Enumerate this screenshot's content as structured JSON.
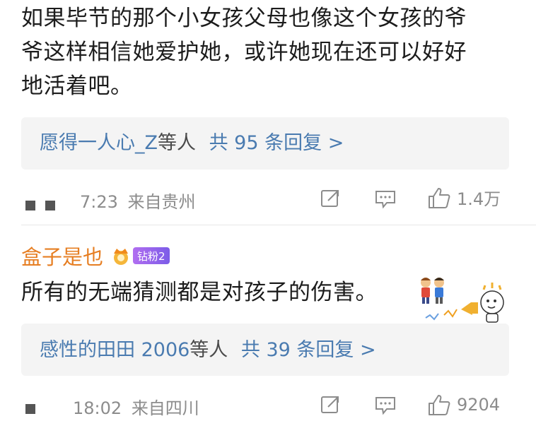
{
  "comment1": {
    "text_line1": "如果毕节的那个小女孩父母也像这个女孩的爷",
    "text_line2": "爷这样相信她爱护她，或许她现在还可以好好",
    "text_line3": "地活着吧。",
    "replies": {
      "name": "愿得一人心_Z",
      "others": "等人",
      "count_label": "共 95 条回复 >"
    },
    "time": "7:23",
    "location": "来自贵州",
    "likes": "1.4万"
  },
  "comment2": {
    "username": "盒子是也",
    "badge": "钻粉2",
    "text": "所有的无端猜测都是对孩子的伤害。",
    "replies": {
      "name": "感性的田田 2006",
      "others": "等人",
      "count_label": "共 39 条回复 >"
    },
    "time": "18:02",
    "location": "来自四川",
    "likes": "9204"
  },
  "colors": {
    "link": "#4a7bb0",
    "username": "#e67e22",
    "meta": "#8c8c8c",
    "reply_bg": "#f4f4f4"
  },
  "icons": [
    "share-icon",
    "comment-icon",
    "like-icon",
    "crown-icon",
    "kids-sticker",
    "megaphone-sticker"
  ]
}
